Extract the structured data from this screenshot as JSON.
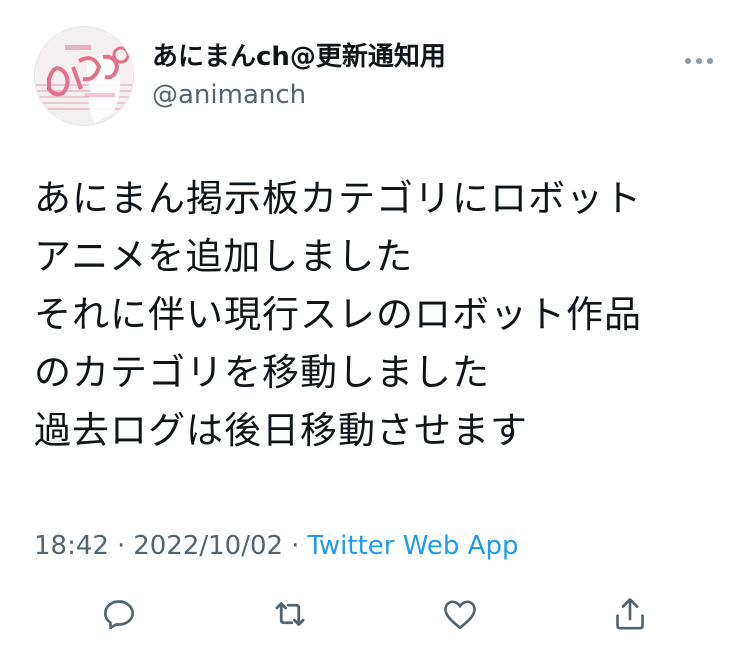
{
  "user": {
    "display_name": "あにまんch@更新通知用",
    "handle": "@animanch",
    "avatar_icon": "animanch-logo-avatar"
  },
  "tweet": {
    "lines": [
      "あにまん掲示板カテゴリにロボット",
      "アニメを追加しました",
      "それに伴い現行スレのロボット作品",
      "のカテゴリを移動しました",
      "過去ログは後日移動させます"
    ]
  },
  "meta": {
    "time": "18:42",
    "separator": "·",
    "date": "2022/10/02",
    "source": "Twitter Web App"
  },
  "actions": {
    "reply_icon": "reply-icon",
    "retweet_icon": "retweet-icon",
    "like_icon": "heart-icon",
    "share_icon": "share-icon",
    "more_icon": "more-dots-icon"
  },
  "colors": {
    "text": "#0f1419",
    "secondary": "#536471",
    "link": "#1d9bf0"
  }
}
